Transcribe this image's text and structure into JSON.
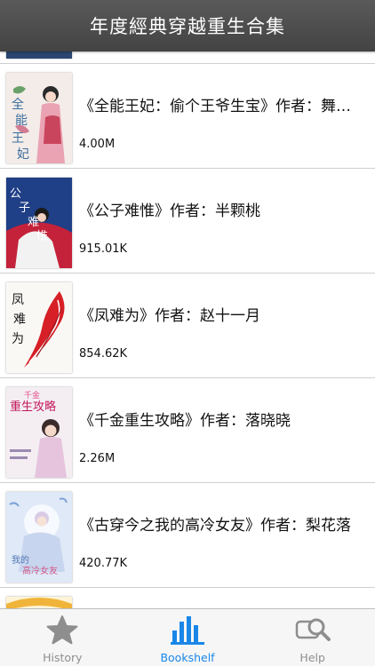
{
  "nav": {
    "title": "年度經典穿越重生合集"
  },
  "books": [
    {
      "title": "《全能王妃：偷个王爷生宝》作者：舞月无痕",
      "size": "4.00M"
    },
    {
      "title": "《公子难惟》作者：半颗桃",
      "size": "915.01K"
    },
    {
      "title": "《凤难为》作者：赵十一月",
      "size": "854.62K"
    },
    {
      "title": "《千金重生攻略》作者：落晓晓",
      "size": "2.26M"
    },
    {
      "title": "《古穿今之我的高冷女友》作者：梨花落",
      "size": "420.77K"
    }
  ],
  "tabs": [
    {
      "label": "History",
      "icon": "star-icon"
    },
    {
      "label": "Bookshelf",
      "icon": "bar-chart-icon"
    },
    {
      "label": "Help",
      "icon": "magnifier-icon"
    }
  ],
  "colors": {
    "nav_bg": "#4e4e4e",
    "tab_active": "#1a87e8",
    "tab_inactive": "#8e8e8e"
  }
}
